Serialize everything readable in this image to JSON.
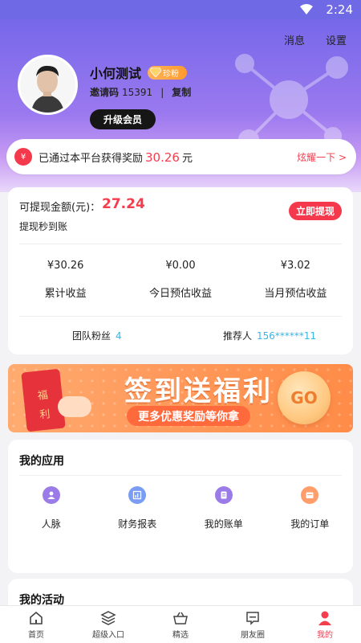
{
  "status_bar": {
    "time": "2:24"
  },
  "header": {
    "messages": "消息",
    "settings": "设置",
    "user_name": "小何测试",
    "vip_badge": "珍粉",
    "invite_label": "邀请码",
    "invite_code": "15391",
    "copy": "复制",
    "upgrade": "升级会员"
  },
  "reward": {
    "prefix": "已通过本平台获得奖励",
    "amount": "30.26",
    "unit": "元",
    "share": "炫耀一下 >"
  },
  "balance": {
    "label": "可提现金额(元)：",
    "value": "27.24",
    "sub": "提现秒到账",
    "withdraw": "立即提现",
    "stats": [
      {
        "value": "¥30.26",
        "label": "累计收益"
      },
      {
        "value": "¥0.00",
        "label": "今日预估收益"
      },
      {
        "value": "¥3.02",
        "label": "当月预估收益"
      }
    ],
    "team_fans_label": "团队粉丝",
    "team_fans_value": "4",
    "referrer_label": "推荐人",
    "referrer_value": "156******11"
  },
  "promo": {
    "envelope_text": "福利",
    "title": "签到送福利",
    "subtitle": "更多优惠奖励等你拿",
    "button": "GO"
  },
  "apps": {
    "title": "我的应用",
    "items": [
      {
        "label": "人脉",
        "icon": "contacts-icon",
        "color": "#9b7be8"
      },
      {
        "label": "财务报表",
        "icon": "report-icon",
        "color": "#7a9cf2"
      },
      {
        "label": "我的账单",
        "icon": "bill-icon",
        "color": "#9b7be8"
      },
      {
        "label": "我的订单",
        "icon": "order-icon",
        "color": "#ff9d6b"
      }
    ]
  },
  "activity": {
    "title": "我的活动"
  },
  "nav": [
    {
      "label": "首页",
      "icon": "home-icon"
    },
    {
      "label": "超级入口",
      "icon": "layers-icon"
    },
    {
      "label": "精选",
      "icon": "basket-icon"
    },
    {
      "label": "朋友圈",
      "icon": "message-icon"
    },
    {
      "label": "我的",
      "icon": "user-icon",
      "active": true
    }
  ],
  "colors": {
    "accent": "#f43d4d",
    "purple": "#7668ea",
    "cyan": "#35b6e5"
  }
}
